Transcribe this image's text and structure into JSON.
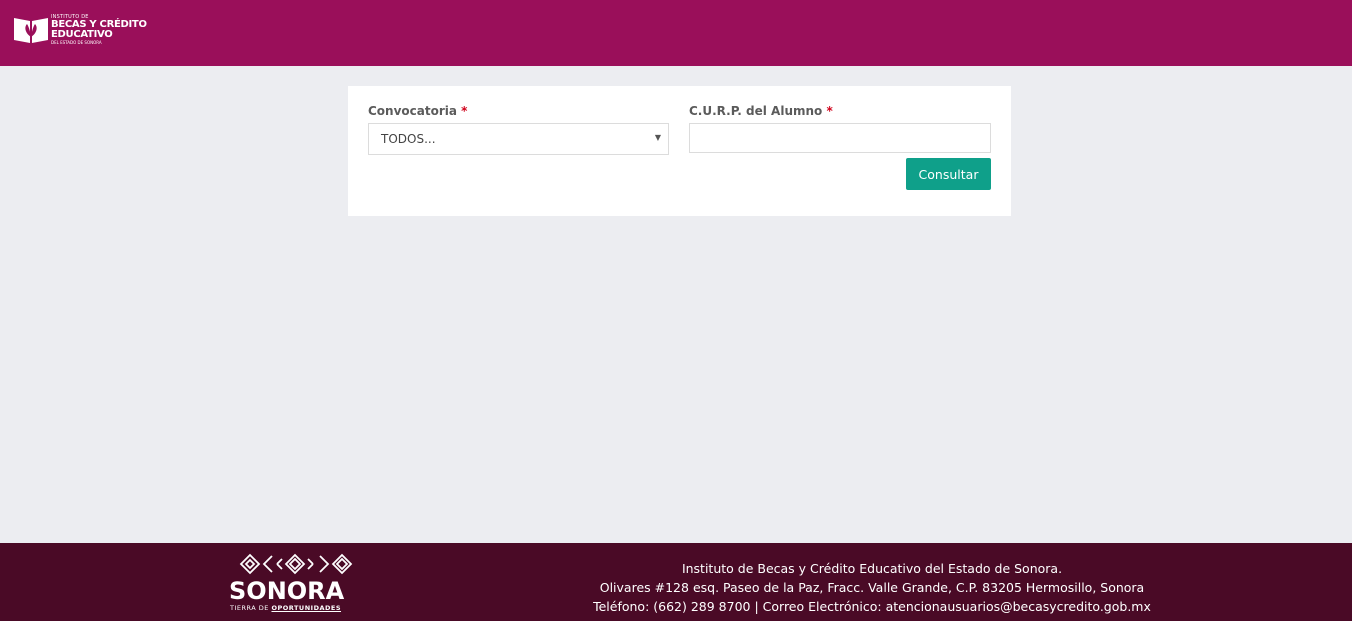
{
  "header": {
    "logo": {
      "line1": "INSTITUTO DE",
      "line2": "BECAS Y CRÉDITO",
      "line3": "EDUCATIVO",
      "line4": "DEL ESTADO DE SONORA",
      "icon": "book-leaf-logo-icon"
    },
    "bg_color": "#9a0f5a"
  },
  "form": {
    "convocatoria_label": "Convocatoria",
    "curp_label": "C.U.R.P. del Alumno",
    "required_mark": "*",
    "convocatoria_value": "TODOS...",
    "curp_value": "",
    "submit_label": "Consultar",
    "button_color": "#0fa08a"
  },
  "footer": {
    "brand": "SONORA",
    "tagline_prefix": "TIERRA DE",
    "tagline_bold": "OPORTUNIDADES",
    "line1": "Instituto de Becas y Crédito Educativo del Estado de Sonora.",
    "line2": "Olivares #128 esq. Paseo de la Paz, Fracc. Valle Grande, C.P. 83205 Hermosillo, Sonora",
    "line3": "Teléfono: (662) 289 8700 | Correo Electrónico: atencionausuarios@becasycredito.gob.mx",
    "bg_color": "#4a0a26"
  }
}
